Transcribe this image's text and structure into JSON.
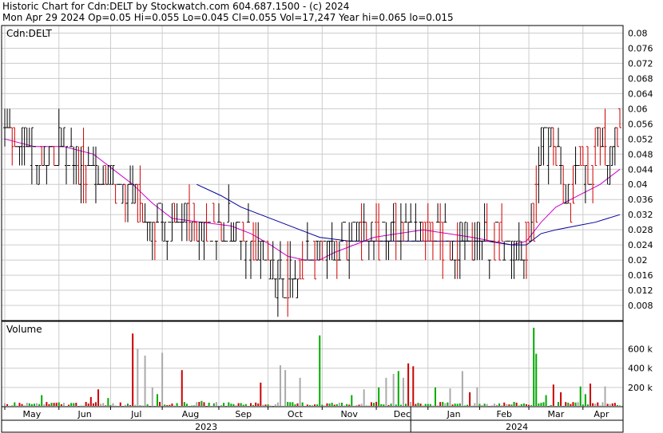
{
  "header": {
    "line1": "Historic Chart for Cdn:DELT by Stockwatch.com 604.687.1500 - (c) 2024",
    "line2": "Mon Apr 29 2024  Op=0.05  Hi=0.055  Lo=0.045  Cl=0.055  Vol=17,247  Year hi=0.065  lo=0.015"
  },
  "colors": {
    "up": "#000000",
    "down": "#cc0000",
    "ma_short": "#cc00cc",
    "ma_long": "#000099",
    "grid": "#cccccc",
    "volume_up": "#00aa00",
    "volume_down": "#cc0000",
    "volume_flat": "#aaaaaa"
  },
  "chart_data": [
    {
      "type": "ohlc",
      "label": "Cdn:DELT",
      "y_ticks": [
        "0.08",
        "0.076",
        "0.072",
        "0.068",
        "0.064",
        "0.06",
        "0.056",
        "0.052",
        "0.048",
        "0.044",
        "0.04",
        "0.036",
        "0.032",
        "0.028",
        "0.024",
        "0.02",
        "0.016",
        "0.012",
        "0.008"
      ],
      "ylim": [
        0.004,
        0.082
      ],
      "months": [
        "May",
        "Jun",
        "Jul",
        "Aug",
        "Sep",
        "Oct",
        "Nov",
        "Dec",
        "Jan",
        "Feb",
        "Mar",
        "Apr"
      ],
      "years": [
        "2023",
        "2024"
      ],
      "x_domain": [
        0,
        250
      ],
      "month_starts": [
        0,
        22,
        43,
        64,
        87,
        107,
        129,
        151,
        172,
        193,
        213,
        235
      ],
      "year_split": 165,
      "anchors": [
        [
          0,
          0.055
        ],
        [
          8,
          0.052
        ],
        [
          16,
          0.045
        ],
        [
          24,
          0.05
        ],
        [
          32,
          0.045
        ],
        [
          40,
          0.042
        ],
        [
          48,
          0.04
        ],
        [
          54,
          0.035
        ],
        [
          60,
          0.03
        ],
        [
          66,
          0.028
        ],
        [
          80,
          0.03
        ],
        [
          95,
          0.028
        ],
        [
          100,
          0.025
        ],
        [
          106,
          0.02
        ],
        [
          112,
          0.016
        ],
        [
          118,
          0.016
        ],
        [
          122,
          0.018
        ],
        [
          126,
          0.022
        ],
        [
          132,
          0.025
        ],
        [
          140,
          0.025
        ],
        [
          150,
          0.027
        ],
        [
          160,
          0.028
        ],
        [
          170,
          0.027
        ],
        [
          178,
          0.026
        ],
        [
          186,
          0.024
        ],
        [
          195,
          0.025
        ],
        [
          203,
          0.024
        ],
        [
          210,
          0.022
        ],
        [
          215,
          0.028
        ],
        [
          218,
          0.05
        ],
        [
          222,
          0.052
        ],
        [
          226,
          0.046
        ],
        [
          230,
          0.032
        ],
        [
          234,
          0.05
        ],
        [
          238,
          0.042
        ],
        [
          242,
          0.055
        ],
        [
          246,
          0.045
        ],
        [
          250,
          0.055
        ]
      ],
      "ma_short": [
        [
          0,
          0.052
        ],
        [
          12,
          0.05
        ],
        [
          24,
          0.05
        ],
        [
          36,
          0.048
        ],
        [
          44,
          0.044
        ],
        [
          52,
          0.04
        ],
        [
          60,
          0.035
        ],
        [
          68,
          0.031
        ],
        [
          80,
          0.03
        ],
        [
          92,
          0.029
        ],
        [
          100,
          0.027
        ],
        [
          108,
          0.024
        ],
        [
          115,
          0.021
        ],
        [
          122,
          0.02
        ],
        [
          128,
          0.02
        ],
        [
          134,
          0.022
        ],
        [
          142,
          0.024
        ],
        [
          150,
          0.026
        ],
        [
          160,
          0.027
        ],
        [
          170,
          0.028
        ],
        [
          180,
          0.027
        ],
        [
          190,
          0.026
        ],
        [
          198,
          0.025
        ],
        [
          206,
          0.024
        ],
        [
          212,
          0.025
        ],
        [
          218,
          0.03
        ],
        [
          224,
          0.034
        ],
        [
          230,
          0.036
        ],
        [
          236,
          0.038
        ],
        [
          242,
          0.04
        ],
        [
          250,
          0.044
        ]
      ],
      "ma_long": [
        [
          78,
          0.04
        ],
        [
          88,
          0.037
        ],
        [
          96,
          0.034
        ],
        [
          104,
          0.032
        ],
        [
          112,
          0.03
        ],
        [
          120,
          0.028
        ],
        [
          128,
          0.026
        ],
        [
          140,
          0.025
        ],
        [
          160,
          0.025
        ],
        [
          180,
          0.025
        ],
        [
          196,
          0.025
        ],
        [
          206,
          0.024
        ],
        [
          212,
          0.024
        ],
        [
          218,
          0.027
        ],
        [
          224,
          0.028
        ],
        [
          232,
          0.029
        ],
        [
          240,
          0.03
        ],
        [
          250,
          0.032
        ]
      ]
    },
    {
      "type": "bar",
      "label": "Volume",
      "y_ticks": [
        "600 k",
        "400 k",
        "200 k"
      ],
      "ylim": [
        0,
        820000
      ],
      "spikes": [
        [
          15,
          120000,
          "g"
        ],
        [
          35,
          100000,
          "r"
        ],
        [
          38,
          180000,
          "r"
        ],
        [
          42,
          90000,
          "g"
        ],
        [
          52,
          760000,
          "r"
        ],
        [
          54,
          600000,
          "x"
        ],
        [
          57,
          530000,
          "x"
        ],
        [
          60,
          200000,
          "x"
        ],
        [
          62,
          130000,
          "g"
        ],
        [
          64,
          560000,
          "x"
        ],
        [
          72,
          380000,
          "r"
        ],
        [
          80,
          60000,
          "g"
        ],
        [
          104,
          250000,
          "r"
        ],
        [
          112,
          430000,
          "x"
        ],
        [
          114,
          380000,
          "x"
        ],
        [
          120,
          300000,
          "x"
        ],
        [
          128,
          740000,
          "g"
        ],
        [
          141,
          120000,
          "g"
        ],
        [
          146,
          180000,
          "x"
        ],
        [
          152,
          200000,
          "g"
        ],
        [
          155,
          300000,
          "x"
        ],
        [
          158,
          340000,
          "x"
        ],
        [
          160,
          370000,
          "g"
        ],
        [
          162,
          300000,
          "x"
        ],
        [
          164,
          450000,
          "r"
        ],
        [
          166,
          420000,
          "r"
        ],
        [
          175,
          200000,
          "g"
        ],
        [
          181,
          190000,
          "x"
        ],
        [
          186,
          370000,
          "x"
        ],
        [
          189,
          150000,
          "r"
        ],
        [
          192,
          200000,
          "x"
        ],
        [
          215,
          820000,
          "g"
        ],
        [
          216,
          550000,
          "g"
        ],
        [
          220,
          120000,
          "g"
        ],
        [
          223,
          230000,
          "r"
        ],
        [
          226,
          150000,
          "r"
        ],
        [
          234,
          210000,
          "g"
        ],
        [
          236,
          130000,
          "g"
        ],
        [
          238,
          240000,
          "r"
        ],
        [
          244,
          210000,
          "x"
        ]
      ]
    }
  ]
}
